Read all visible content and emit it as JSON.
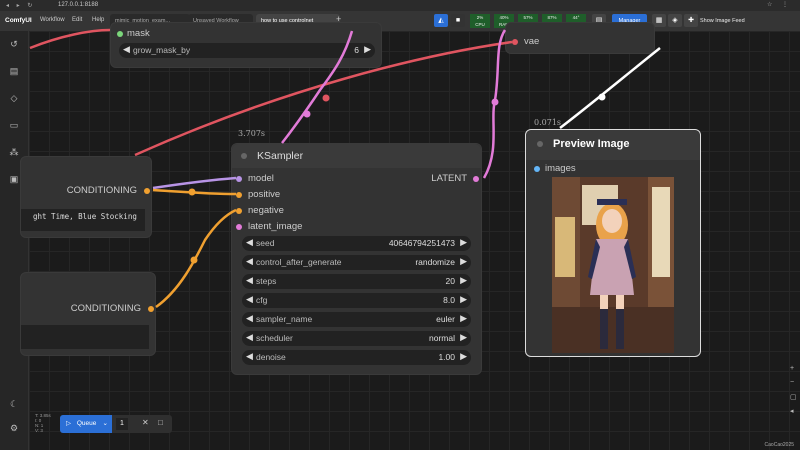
{
  "browser": {
    "url": "127.0.0.1:8188"
  },
  "app": {
    "logo": "ComfyUI",
    "menu": [
      "Workflow",
      "Edit",
      "Help"
    ],
    "tabs": [
      "mimic_motion_exam...",
      "Unsaved Workflow",
      "how to use controlnet"
    ],
    "active_tab_index": 2,
    "stats": [
      {
        "label": "CPU",
        "value": "2%"
      },
      {
        "label": "RAM",
        "value": "40%"
      },
      {
        "label": "GPU",
        "value": "57%"
      },
      {
        "label": "VRAM",
        "value": "87%"
      },
      {
        "label": "Temp",
        "value": "44°"
      }
    ],
    "manager_label": "Manager",
    "feed_label": "Show Image Feed"
  },
  "nodes": {
    "top": {
      "mask_label": "mask",
      "grow_name": "grow_mask_by",
      "grow_value": "6",
      "vae_label": "vae"
    },
    "cond1": {
      "output_label": "CONDITIONING",
      "text": "ght Time, Blue Stocking"
    },
    "cond2": {
      "output_label": "CONDITIONING"
    },
    "ksampler": {
      "timing": "3.707s",
      "title": "KSampler",
      "inputs": [
        "model",
        "positive",
        "negative",
        "latent_image"
      ],
      "output": "LATENT",
      "widgets": [
        {
          "name": "seed",
          "value": "40646794251473"
        },
        {
          "name": "control_after_generate",
          "value": "randomize"
        },
        {
          "name": "steps",
          "value": "20"
        },
        {
          "name": "cfg",
          "value": "8.0"
        },
        {
          "name": "sampler_name",
          "value": "euler"
        },
        {
          "name": "scheduler",
          "value": "normal"
        },
        {
          "name": "denoise",
          "value": "1.00"
        }
      ]
    },
    "preview": {
      "timing": "0.071s",
      "title": "Preview Image",
      "input_label": "images"
    }
  },
  "queue": {
    "label": "Queue",
    "count": "1"
  },
  "mini_stats": [
    "T: 3.85s",
    "I: 0",
    "N: 1",
    "V: 3"
  ],
  "corner_text": "CaoCao2025",
  "colors": {
    "wire_red": "#e05560",
    "wire_pink": "#e27bd8",
    "wire_orange": "#f0a030",
    "wire_lavender": "#b894e6",
    "wire_white": "#ffffff",
    "accent_blue": "#2b6fd6"
  }
}
